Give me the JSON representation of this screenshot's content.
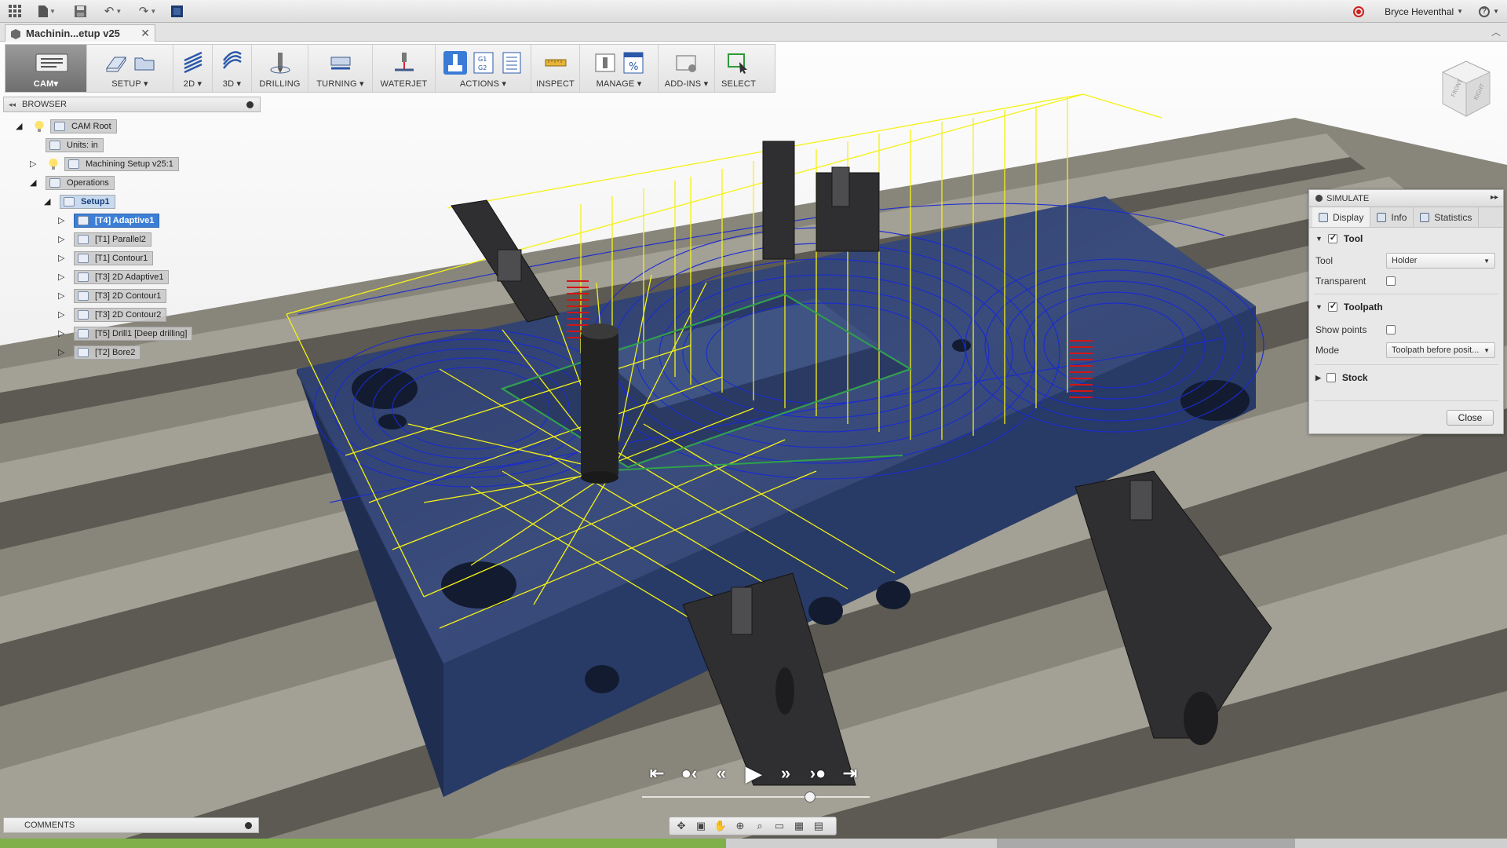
{
  "app": {
    "user": "Bryce Heventhal",
    "document_tab": "Machinin...etup v25"
  },
  "ribbon": {
    "workspace": "CAM",
    "groups": [
      {
        "label": "SETUP"
      },
      {
        "label": "2D"
      },
      {
        "label": "3D"
      },
      {
        "label": "DRILLING"
      },
      {
        "label": "TURNING"
      },
      {
        "label": "WATERJET"
      },
      {
        "label": "ACTIONS"
      },
      {
        "label": "INSPECT"
      },
      {
        "label": "MANAGE"
      },
      {
        "label": "ADD-INS"
      },
      {
        "label": "SELECT"
      }
    ],
    "actions_text": [
      "G1",
      "G2"
    ]
  },
  "browser": {
    "title": "BROWSER",
    "nodes": [
      {
        "label": "CAM Root"
      },
      {
        "label": "Units: in"
      },
      {
        "label": "Machining Setup v25:1"
      },
      {
        "label": "Operations"
      },
      {
        "label": "Setup1"
      },
      {
        "label": "[T4] Adaptive1"
      },
      {
        "label": "[T1] Parallel2"
      },
      {
        "label": "[T1] Contour1"
      },
      {
        "label": "[T3] 2D Adaptive1"
      },
      {
        "label": "[T3] 2D Contour1"
      },
      {
        "label": "[T3] 2D Contour2"
      },
      {
        "label": "[T5] Drill1 [Deep drilling]"
      },
      {
        "label": "[T2] Bore2"
      }
    ]
  },
  "simulate": {
    "title": "SIMULATE",
    "tabs": [
      "Display",
      "Info",
      "Statistics"
    ],
    "tool_section": "Tool",
    "tool_label": "Tool",
    "tool_value": "Holder",
    "transparent_label": "Transparent",
    "toolpath_section": "Toolpath",
    "show_points_label": "Show points",
    "mode_label": "Mode",
    "mode_value": "Toolpath before posit...",
    "stock_section": "Stock",
    "close_label": "Close",
    "tool_checked": true,
    "toolpath_checked": true,
    "stock_checked": false,
    "transparent_checked": false,
    "show_points_checked": false
  },
  "comments": {
    "title": "COMMENTS"
  },
  "viewcube": {
    "faces": [
      "FRONT",
      "RIGHT"
    ]
  },
  "colors": {
    "toolpath_feed": "#1a2bd0",
    "toolpath_rapid": "#f4f215",
    "part": "#34476e",
    "selection": "#3d7fd6",
    "timeline_done": "#7fb04a"
  }
}
